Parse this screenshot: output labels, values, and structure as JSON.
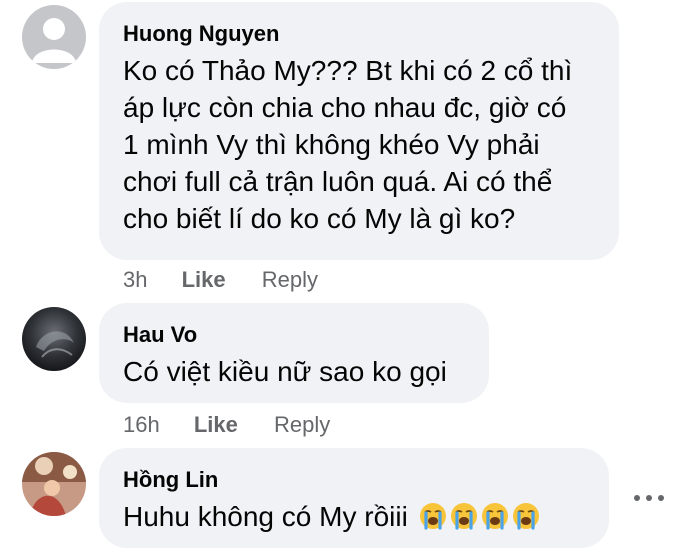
{
  "comments": [
    {
      "author": "Huong Nguyen",
      "lines": [
        "Ko có Thảo My??? Bt khi có 2 cổ thì",
        "áp lực còn chia cho nhau đc, giờ có",
        "1 mình Vy thì không khéo Vy phải",
        "chơi full cả trận luôn quá. Ai có thể",
        "cho biết lí do ko có My là gì ko?"
      ],
      "time": "3h",
      "like_label": "Like",
      "reply_label": "Reply",
      "avatar_icon": "default-profile-icon"
    },
    {
      "author": "Hau Vo",
      "lines": [
        "Có việt kiều nữ sao ko gọi"
      ],
      "time": "16h",
      "like_label": "Like",
      "reply_label": "Reply",
      "avatar_icon": "profile-photo"
    },
    {
      "author": "Hồng Lin",
      "text": "Huhu không có My rồiii",
      "emojis": [
        "loudly-crying-face-emoji",
        "loudly-crying-face-emoji",
        "loudly-crying-face-emoji",
        "loudly-crying-face-emoji"
      ],
      "avatar_icon": "profile-photo"
    }
  ],
  "more_options_icon": "more-horizontal-icon",
  "colors": {
    "bubble_bg": "#f0f2f5",
    "text": "#050505",
    "secondary_text": "#65676b"
  }
}
